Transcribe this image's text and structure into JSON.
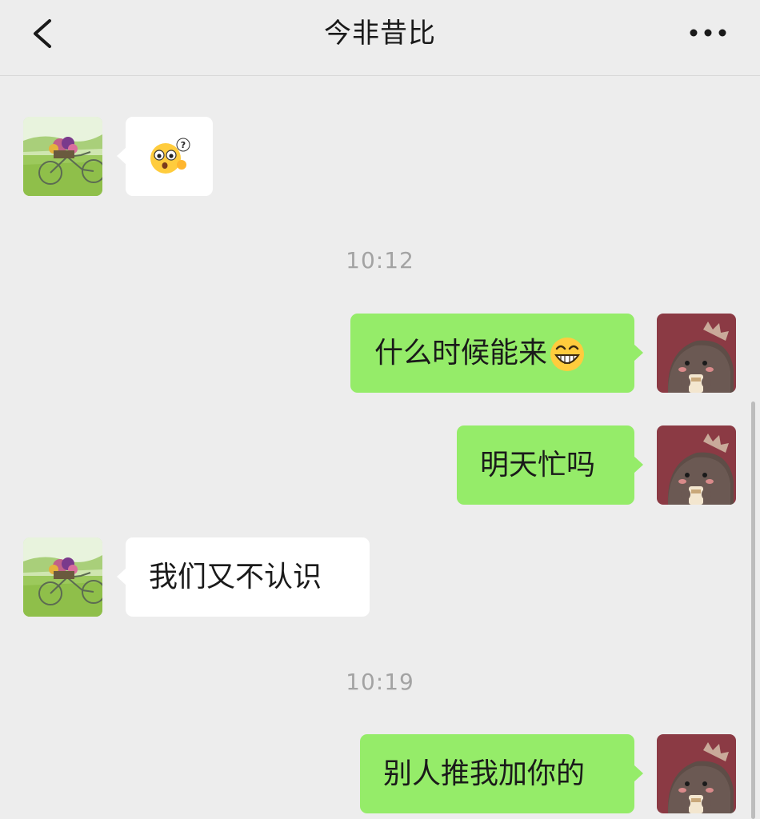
{
  "header": {
    "title": "今非昔比",
    "back_icon": "chevron-left-icon",
    "more_icon": "more-dots-icon"
  },
  "messages": [
    {
      "sender": "other",
      "type": "sticker",
      "sticker": "confused-face-emoji"
    },
    {
      "type": "timestamp",
      "text": "10:12"
    },
    {
      "sender": "me",
      "type": "text",
      "text": "什么时候能来",
      "emoji": "grinning-face-emoji"
    },
    {
      "sender": "me",
      "type": "text",
      "text": "明天忙吗"
    },
    {
      "sender": "other",
      "type": "text",
      "text": "我们又不认识"
    },
    {
      "type": "timestamp",
      "text": "10:19"
    },
    {
      "sender": "me",
      "type": "text",
      "text": "别人推我加你的"
    }
  ],
  "colors": {
    "background": "#ededed",
    "my_bubble": "#95ec69",
    "other_bubble": "#ffffff",
    "timestamp": "#a3a3a3",
    "my_avatar_bg": "#8b3a44"
  }
}
